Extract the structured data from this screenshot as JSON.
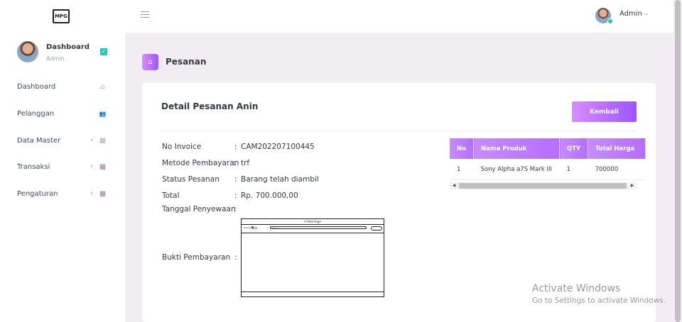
{
  "sidebar": {
    "logo_text": "MPG",
    "profile": {
      "name": "Dashboard",
      "role": "Admin"
    },
    "items": [
      {
        "label": "Dashboard",
        "chevron": "",
        "icon": "home-icon",
        "glyph": "⌂"
      },
      {
        "label": "Pelanggan",
        "chevron": "",
        "icon": "users-icon",
        "glyph": "👥"
      },
      {
        "label": "Data Master",
        "chevron": "‹",
        "icon": "grid-icon",
        "glyph": "▦"
      },
      {
        "label": "Transaksi",
        "chevron": "‹",
        "icon": "bag-icon",
        "glyph": "■"
      },
      {
        "label": "Pengaturan",
        "chevron": "‹",
        "icon": "bag-icon",
        "glyph": "■"
      }
    ]
  },
  "topbar": {
    "user_name": "Admin",
    "caret": "⌄"
  },
  "page": {
    "title": "Pesanan",
    "home_glyph": "⌂"
  },
  "card": {
    "title": "Detail Pesanan Anin",
    "back_label": "Kembali",
    "fields": [
      {
        "label": "No Invoice",
        "colon": ":",
        "value": "CAM202207100445"
      },
      {
        "label": "Metode Pembayaran",
        "colon": ":",
        "value": "trf"
      },
      {
        "label": "Status Pesanan",
        "colon": ":",
        "value": "Barang telah diambil"
      },
      {
        "label": "Total",
        "colon": ":",
        "value": "Rp. 700.000,00"
      },
      {
        "label": "Tanggal Penyewaan",
        "colon": ":",
        "value": ""
      },
      {
        "label": "Bukti Pembayaran",
        "colon": ":",
        "value": ""
      }
    ],
    "proof_image": {
      "title": "A Web Page",
      "url": "https://"
    }
  },
  "table": {
    "headers": [
      "No",
      "Nama Produk",
      "QTY",
      "Total Harga"
    ],
    "rows": [
      [
        "1",
        "Sony Alpha a7S Mark III",
        "1",
        "700000"
      ]
    ]
  },
  "watermark": {
    "line1": "Activate Windows",
    "line2": "Go to Settings to activate Windows."
  },
  "colors": {
    "accent_start": "#da8cff",
    "accent_end": "#9a55ff",
    "background": "#f2edf3",
    "success": "#1bcfb4"
  }
}
